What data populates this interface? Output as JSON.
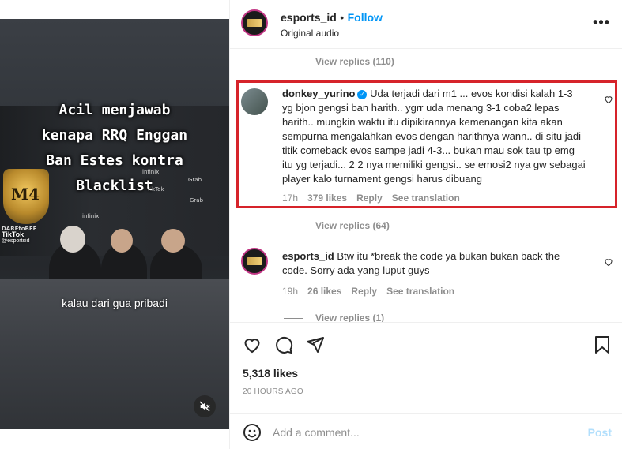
{
  "video": {
    "overlay_title": "Acil menjawab\nkenapa RRQ Enggan\nBan Estes kontra\nBlacklist",
    "subtitle": "kalau dari gua pribadi",
    "watermark": "TikTok",
    "watermark_user": "@esportsid",
    "logo_text": "M4",
    "backdrop_text": [
      "infinix",
      "Grab",
      "TikTok",
      "Grab",
      "infinix",
      "DAREtoBEE"
    ],
    "mute_icon": "speaker-muted-icon"
  },
  "header": {
    "username": "esports_id",
    "separator": "•",
    "follow_label": "Follow",
    "audio_label": "Original audio",
    "more_label": "•••"
  },
  "comments": {
    "view_replies_top": "View replies (110)",
    "highlighted": {
      "username": "donkey_yurino",
      "text": "Uda terjadi dari m1 ... evos kondisi kalah 1-3 yg bjon gengsi ban harith.. ygrr uda menang 3-1 coba2 lepas harith.. mungkin waktu itu dipikirannya kemenangan kita akan sempurna mengalahkan evos dengan harithnya wann.. di situ jadi titik comeback evos sampe jadi 4-3... bukan mau sok tau tp emg itu yg terjadi... 2 2 nya memiliki gengsi.. se emosi2 nya gw sebagai player kalo turnament gengsi harus dibuang",
      "age": "17h",
      "likes": "379 likes",
      "reply": "Reply",
      "translate": "See translation"
    },
    "view_replies_mid": "View replies (64)",
    "second": {
      "username": "esports_id",
      "text": "Btw itu *break the code ya bukan bukan back the code. Sorry ada yang luput guys",
      "age": "19h",
      "likes": "26 likes",
      "reply": "Reply",
      "translate": "See translation"
    },
    "view_replies_bottom": "View replies (1)"
  },
  "actions": {
    "likes": "5,318 likes",
    "time": "20 HOURS AGO"
  },
  "add_comment": {
    "placeholder": "Add a comment...",
    "post_label": "Post"
  },
  "colors": {
    "accent": "#0095f6",
    "highlight_border": "#d6232a",
    "muted_text": "#8e8e8e"
  }
}
